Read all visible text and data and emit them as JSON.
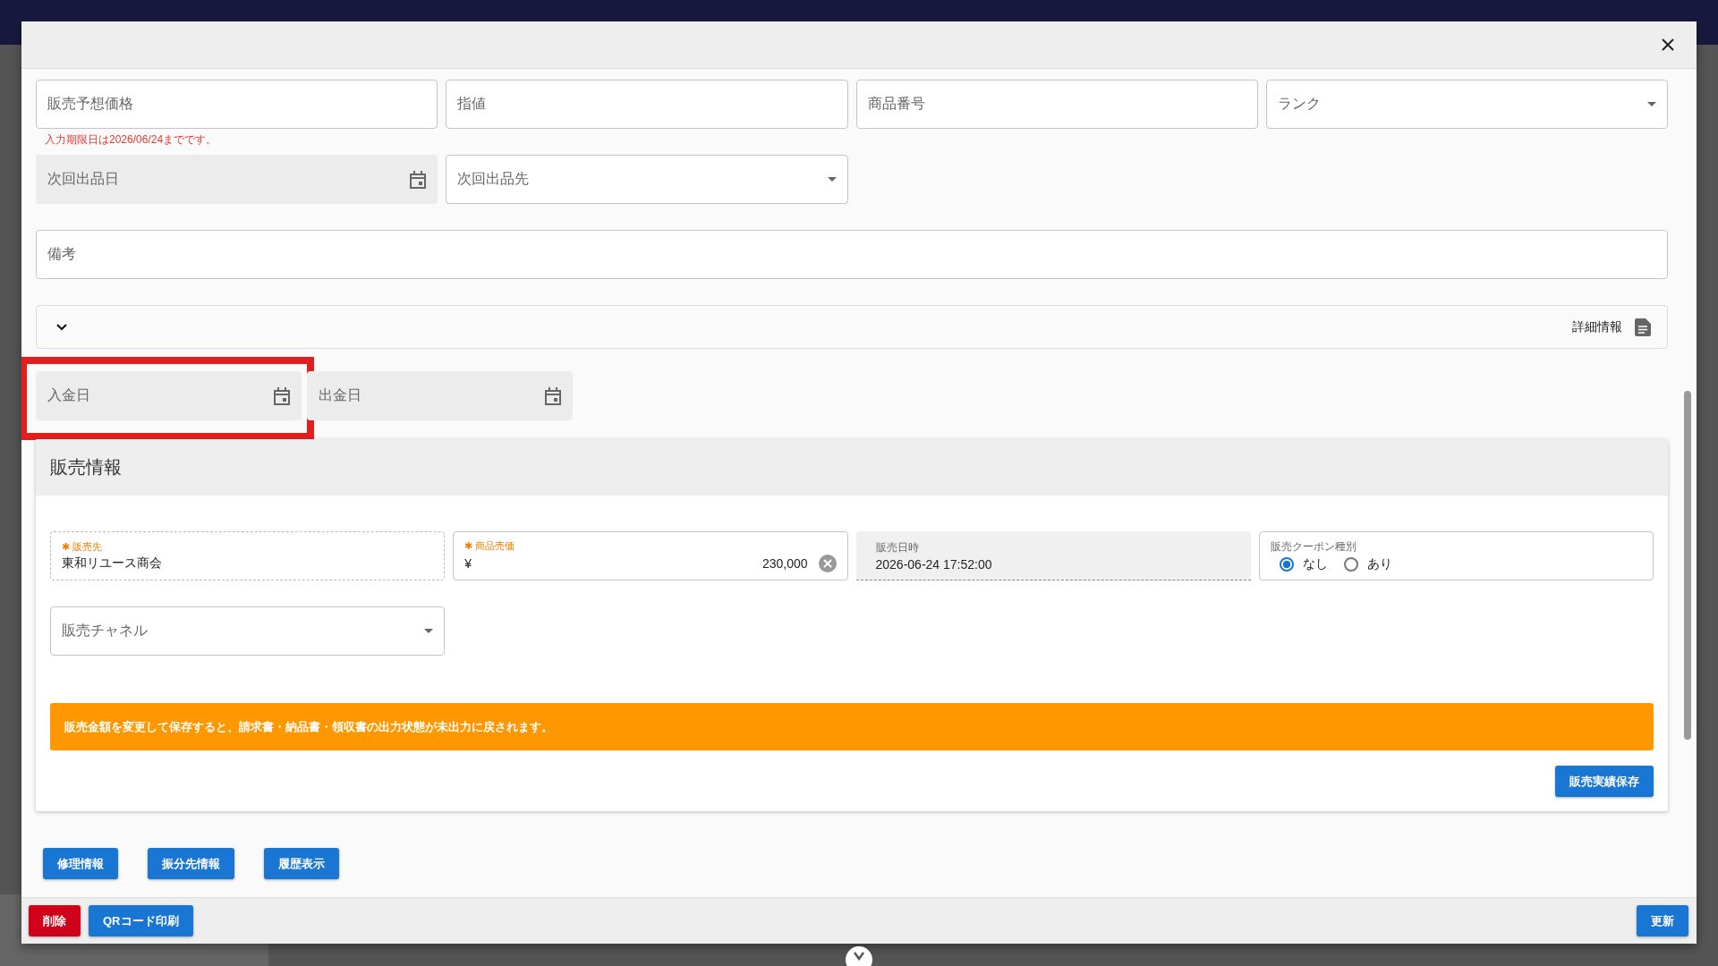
{
  "form_rows": [
    [
      {
        "label": "販売予想価格",
        "kind": "text",
        "error": "入力期限日は2026/06/24までです。"
      },
      {
        "label": "指値",
        "kind": "text"
      },
      {
        "label": "商品番号",
        "kind": "text"
      },
      {
        "label": "ランク",
        "kind": "select"
      }
    ],
    [
      {
        "label": "次回出品日",
        "kind": "date"
      },
      {
        "label": "次回出品先",
        "kind": "select"
      }
    ],
    [
      {
        "label": "備考",
        "kind": "wide"
      }
    ]
  ],
  "detail_panel": {
    "label": "詳細情報",
    "expanded": false
  },
  "payment_dates": [
    {
      "label": "入金日",
      "highlighted": true
    },
    {
      "label": "出金日",
      "highlighted": false
    }
  ],
  "sales": {
    "title": "販売情報",
    "fields": [
      {
        "kind": "readonly",
        "label": "販売先",
        "required_mark": "✱",
        "value": "東和リユース商会"
      },
      {
        "kind": "currency",
        "label": "商品売価",
        "required_mark": "✱",
        "prefix": "¥",
        "value": "230,000"
      },
      {
        "kind": "disabled",
        "label": "販売日時",
        "value": "2026-06-24 17:52:00"
      },
      {
        "kind": "radio",
        "label": "販売クーポン種別",
        "options": [
          {
            "label": "なし",
            "selected": true
          },
          {
            "label": "あり",
            "selected": false
          }
        ]
      }
    ],
    "channel": {
      "label": "販売チャネル"
    },
    "warning": "販売金額を変更して保存すると、請求書・納品書・領収書の出力状態が未出力に戻されます。",
    "save_button": "販売実績保存"
  },
  "action_buttons": [
    "修理情報",
    "振分先情報",
    "履歴表示"
  ],
  "footer": {
    "left": [
      {
        "label": "削除",
        "kind": "danger"
      },
      {
        "label": "QRコード印刷",
        "kind": "primary"
      }
    ],
    "right": [
      {
        "label": "更新",
        "kind": "primary"
      }
    ]
  }
}
